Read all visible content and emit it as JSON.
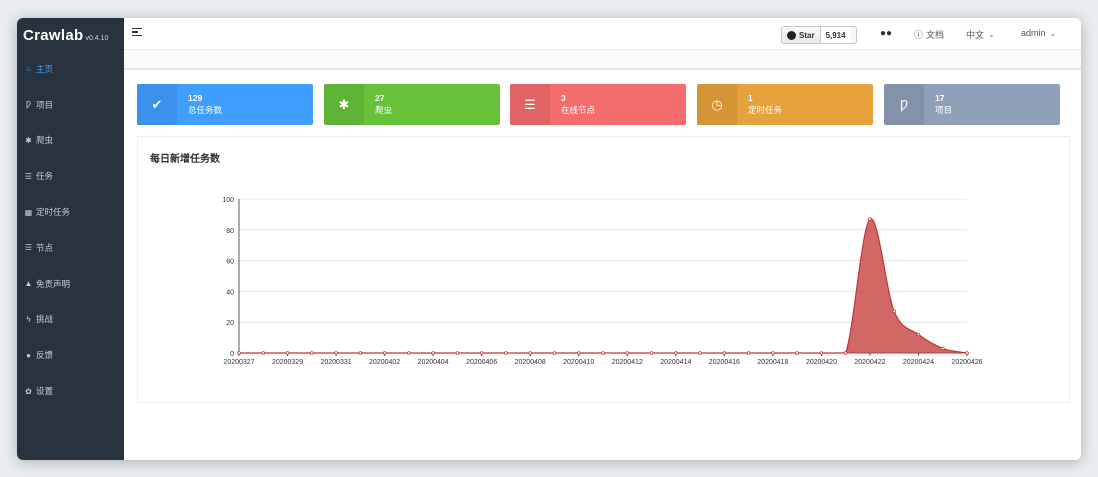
{
  "app": {
    "name": "Crawlab",
    "version": "v0.4.10"
  },
  "sidebar": {
    "items": [
      {
        "icon": "home-icon",
        "glyph": "⌂",
        "label": "主页",
        "active": true
      },
      {
        "icon": "project-icon",
        "glyph": "Ƿ",
        "label": "项目",
        "active": false
      },
      {
        "icon": "bug-icon",
        "glyph": "✱",
        "label": "爬虫",
        "active": false
      },
      {
        "icon": "list-icon",
        "glyph": "☰",
        "label": "任务",
        "active": false
      },
      {
        "icon": "calendar-icon",
        "glyph": "▦",
        "label": "定时任务",
        "active": false
      },
      {
        "icon": "server-icon",
        "glyph": "☰",
        "label": "节点",
        "active": false
      },
      {
        "icon": "warning-icon",
        "glyph": "▲",
        "label": "免责声明",
        "active": false
      },
      {
        "icon": "bolt-icon",
        "glyph": "ϟ",
        "label": "挑战",
        "active": false
      },
      {
        "icon": "comment-icon",
        "glyph": "●",
        "label": "反馈",
        "active": false
      },
      {
        "icon": "gear-icon",
        "glyph": "✿",
        "label": "设置",
        "active": false
      }
    ]
  },
  "header": {
    "star_label": "Star",
    "star_count": "5,914",
    "docs_label": "文档",
    "lang_label": "中文",
    "user_label": "admin"
  },
  "cards": [
    {
      "value": "129",
      "label": "总任务数",
      "icon": "check-icon",
      "glyph": "✔",
      "color": "#409eff"
    },
    {
      "value": "27",
      "label": "爬虫",
      "icon": "bug-icon",
      "glyph": "✱",
      "color": "#67c23a"
    },
    {
      "value": "3",
      "label": "在线节点",
      "icon": "server-icon",
      "glyph": "☰",
      "color": "#f56c6c"
    },
    {
      "value": "1",
      "label": "定时任务",
      "icon": "clock-icon",
      "glyph": "◷",
      "color": "#e6a23c"
    },
    {
      "value": "17",
      "label": "项目",
      "icon": "project-icon",
      "glyph": "Ƿ",
      "color": "#909fb8"
    }
  ],
  "chart_title": "每日新增任务数",
  "chart_data": {
    "type": "area",
    "title": "每日新增任务数",
    "xlabel": "",
    "ylabel": "",
    "ylim": [
      0,
      100
    ],
    "yticks": [
      0,
      20,
      40,
      60,
      80,
      100
    ],
    "x": [
      "20200327",
      "20200328",
      "20200329",
      "20200330",
      "20200331",
      "20200401",
      "20200402",
      "20200403",
      "20200404",
      "20200405",
      "20200406",
      "20200407",
      "20200408",
      "20200409",
      "20200410",
      "20200411",
      "20200412",
      "20200413",
      "20200414",
      "20200415",
      "20200416",
      "20200417",
      "20200418",
      "20200419",
      "20200420",
      "20200421",
      "20200422",
      "20200423",
      "20200424",
      "20200425",
      "20200426"
    ],
    "xtick_labels": [
      "20200327",
      "20200329",
      "20200331",
      "20200402",
      "20200404",
      "20200406",
      "20200408",
      "20200410",
      "20200412",
      "20200414",
      "20200416",
      "20200418",
      "20200420",
      "20200422",
      "20200424",
      "20200426"
    ],
    "series": [
      {
        "values": [
          0,
          0,
          0,
          0,
          0,
          0,
          0,
          0,
          0,
          0,
          0,
          0,
          0,
          0,
          0,
          0,
          0,
          0,
          0,
          0,
          0,
          0,
          0,
          0,
          0,
          0,
          87,
          27,
          12,
          3,
          0
        ]
      }
    ],
    "color": "#c23531",
    "grid": true
  }
}
